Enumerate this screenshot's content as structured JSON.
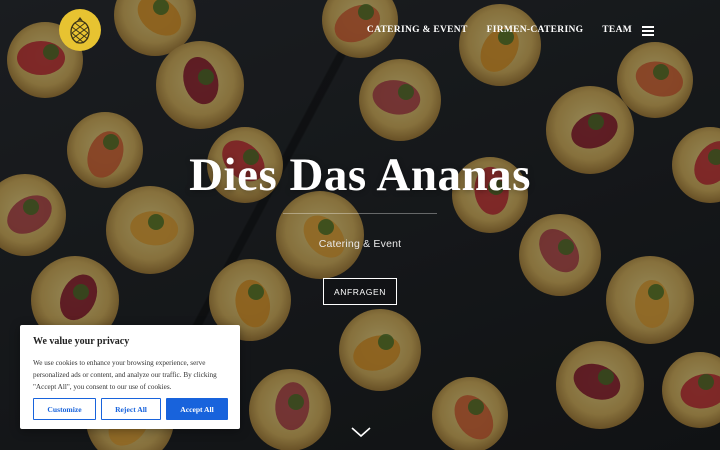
{
  "nav": {
    "links": [
      "CATERING & EVENT",
      "FIRMEN-CATERING",
      "TEAM"
    ]
  },
  "hero": {
    "title": "Dies Das Ananas",
    "subtitle": "Catering & Event",
    "button_label": "ANFRAGEN"
  },
  "cookie": {
    "title": "We value your privacy",
    "text": "We use cookies to enhance your browsing experience, serve personalized ads or content, and analyze our traffic. By clicking \"Accept All\", you consent to our use of cookies.",
    "buttons": {
      "customize": "Customize",
      "reject": "Reject All",
      "accept": "Accept All"
    }
  },
  "colors": {
    "brand_yellow": "#e7c331",
    "accent_blue": "#1863dc"
  },
  "icons": {
    "logo": "pineapple-icon",
    "menu": "hamburger-icon",
    "scroll": "chevron-down-icon"
  }
}
